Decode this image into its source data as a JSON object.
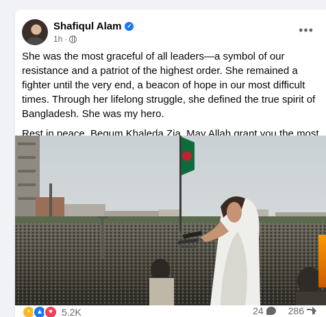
{
  "post": {
    "author": "Shafiqul Alam",
    "verified": true,
    "time": "1h",
    "audience_icon": "globe-icon",
    "more_label": "•••",
    "paragraphs": [
      "She was the most graceful of all leaders—a symbol of our resistance and a patriot of the highest order. She remained a fighter until the very end, a beacon of hope in our most difficult times. Through her lifelong struggle, she defined the true spirit of Bangladesh. She was my hero.",
      "Rest in peace, Begum Khaleda Zia. May Allah grant you the most beautiful place in Jannah. May you rest in eternal peace."
    ]
  },
  "footer": {
    "reaction_icons": [
      "sad-icon",
      "like-icon",
      "love-icon"
    ],
    "reaction_count": "5.2K",
    "comment_count": "24",
    "share_count": "286"
  },
  "colors": {
    "accent": "#1877f2",
    "muted_text": "#65676b",
    "text": "#050505",
    "page_bg": "#f0f2f5"
  }
}
